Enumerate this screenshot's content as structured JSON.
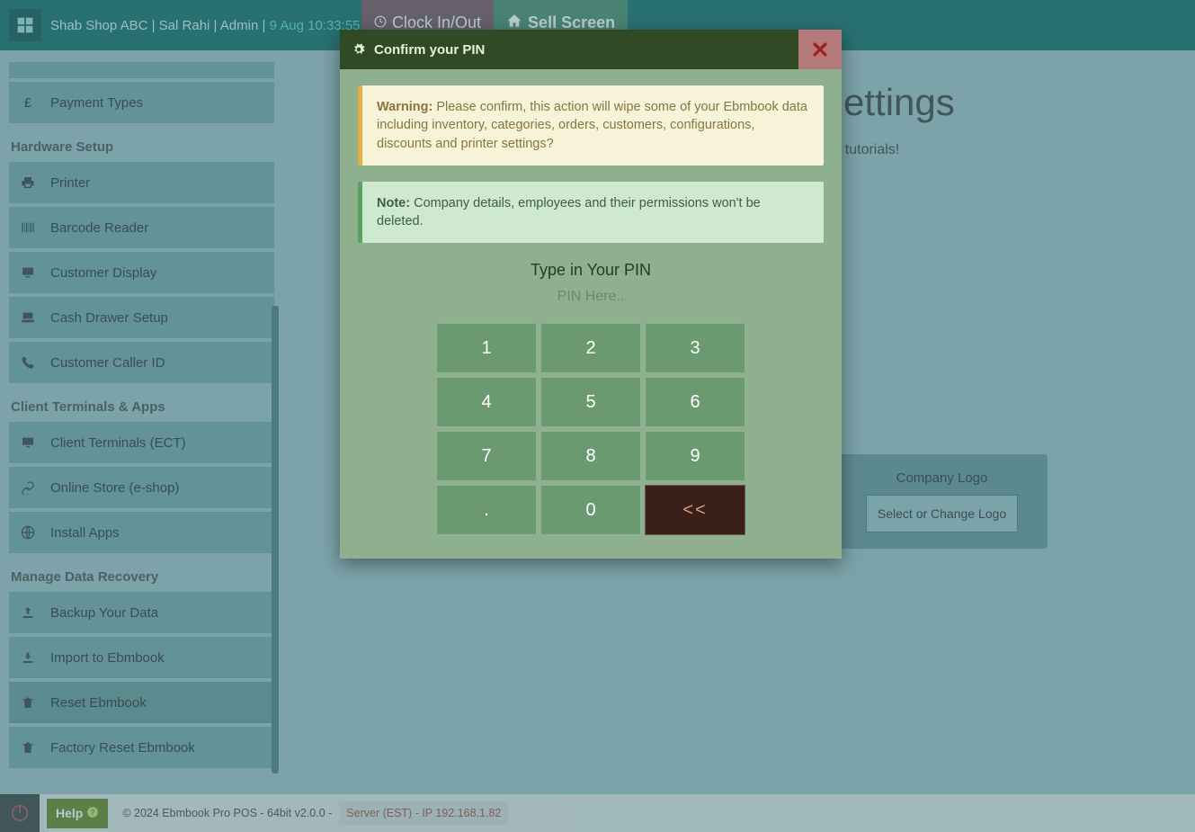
{
  "topbar": {
    "shop": "Shab Shop ABC",
    "user": "Sal Rahi",
    "role": "Admin",
    "timestamp": "9 Aug 10:33:55",
    "clock_label": "Clock In/Out",
    "sell_label": "Sell Screen"
  },
  "sidebar": {
    "item_stub": "",
    "payment_types": "Payment Types",
    "sec_hardware": "Hardware Setup",
    "printer": "Printer",
    "barcode": "Barcode Reader",
    "cust_display": "Customer Display",
    "cash_drawer": "Cash Drawer Setup",
    "caller_id": "Customer Caller ID",
    "sec_clients": "Client Terminals & Apps",
    "client_terminals": "Client Terminals (ECT)",
    "online_store": "Online Store (e-shop)",
    "install_apps": "Install Apps",
    "sec_recovery": "Manage Data Recovery",
    "backup": "Backup Your Data",
    "import": "Import to Ebmbook",
    "reset": "Reset Ebmbook",
    "factory_reset": "Factory Reset Ebmbook"
  },
  "main": {
    "title_partial": "Settings",
    "subtitle_partial": "r tutorials!"
  },
  "logo_panel": {
    "title": "Company Logo",
    "button": "Select or Change Logo"
  },
  "footer": {
    "help": "Help",
    "copy": "© 2024 Ebmbook Pro POS - 64bit v2.0.0 -",
    "server": "Server (EST) - IP 192.168.1.82"
  },
  "modal": {
    "title": "Confirm your PIN",
    "warning_label": "Warning:",
    "warning_text": " Please confirm, this action will wipe some of your Ebmbook data including inventory, categories, orders, customers, configurations, discounts and printer settings?",
    "note_label": "Note:",
    "note_text": " Company details, employees and their permissions won't be deleted.",
    "pin_title": "Type in Your PIN",
    "pin_placeholder": "PIN Here..",
    "keys": {
      "k1": "1",
      "k2": "2",
      "k3": "3",
      "k4": "4",
      "k5": "5",
      "k6": "6",
      "k7": "7",
      "k8": "8",
      "k9": "9",
      "kdot": ".",
      "k0": "0",
      "kback": "<<"
    }
  }
}
